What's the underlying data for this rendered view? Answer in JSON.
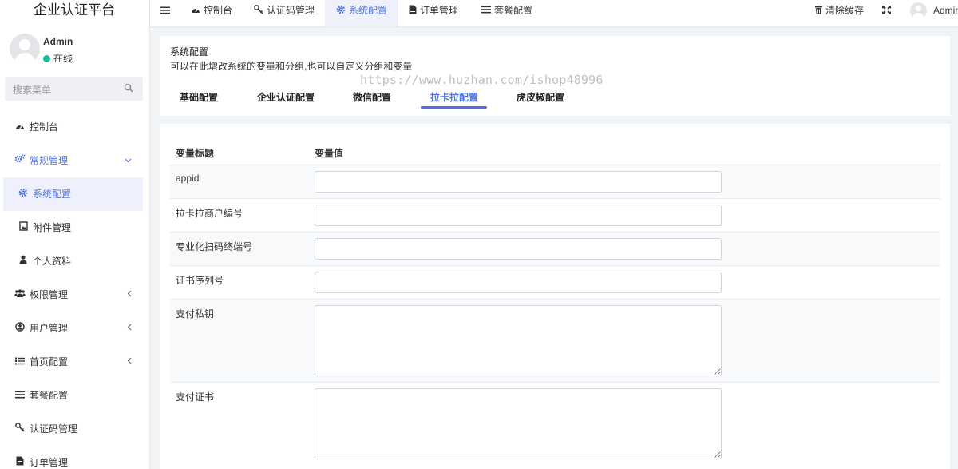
{
  "app": {
    "title": "企业认证平台"
  },
  "user": {
    "name": "Admin",
    "status": "在线"
  },
  "search": {
    "placeholder": "搜索菜单"
  },
  "sidebar": {
    "items": [
      {
        "label": "控制台",
        "icon": "dashboard-icon"
      },
      {
        "label": "常规管理",
        "icon": "cogs-icon"
      },
      {
        "label": "系统配置",
        "icon": "gear-icon"
      },
      {
        "label": "附件管理",
        "icon": "image-file-icon"
      },
      {
        "label": "个人资料",
        "icon": "user-icon"
      },
      {
        "label": "权限管理",
        "icon": "users-icon"
      },
      {
        "label": "用户管理",
        "icon": "user-circle-icon"
      },
      {
        "label": "首页配置",
        "icon": "list-icon"
      },
      {
        "label": "套餐配置",
        "icon": "bars-icon"
      },
      {
        "label": "认证码管理",
        "icon": "key-icon"
      },
      {
        "label": "订单管理",
        "icon": "file-icon"
      }
    ]
  },
  "topnav": {
    "items": [
      {
        "label": "控制台"
      },
      {
        "label": "认证码管理"
      },
      {
        "label": "系统配置"
      },
      {
        "label": "订单管理"
      },
      {
        "label": "套餐配置"
      }
    ],
    "clear_cache": "清除缓存",
    "admin": "Admin"
  },
  "page": {
    "title": "系统配置",
    "description": "可以在此增改系统的变量和分组,也可以自定义分组和变量",
    "watermark": "https://www.huzhan.com/ishop48996"
  },
  "tabs": [
    {
      "label": "基础配置"
    },
    {
      "label": "企业认证配置"
    },
    {
      "label": "微信配置"
    },
    {
      "label": "拉卡拉配置"
    },
    {
      "label": "虎皮椒配置"
    }
  ],
  "table": {
    "headers": {
      "title": "变量标题",
      "value": "变量值"
    },
    "rows": [
      {
        "label": "appid",
        "value": ""
      },
      {
        "label": "拉卡拉商户编号",
        "value": ""
      },
      {
        "label": "专业化扫码终端号",
        "value": ""
      },
      {
        "label": "证书序列号",
        "value": ""
      },
      {
        "label": "支付私钥",
        "value": ""
      },
      {
        "label": "支付证书",
        "value": ""
      }
    ]
  },
  "colors": {
    "accent": "#4e73df",
    "online": "#18bc9c"
  }
}
